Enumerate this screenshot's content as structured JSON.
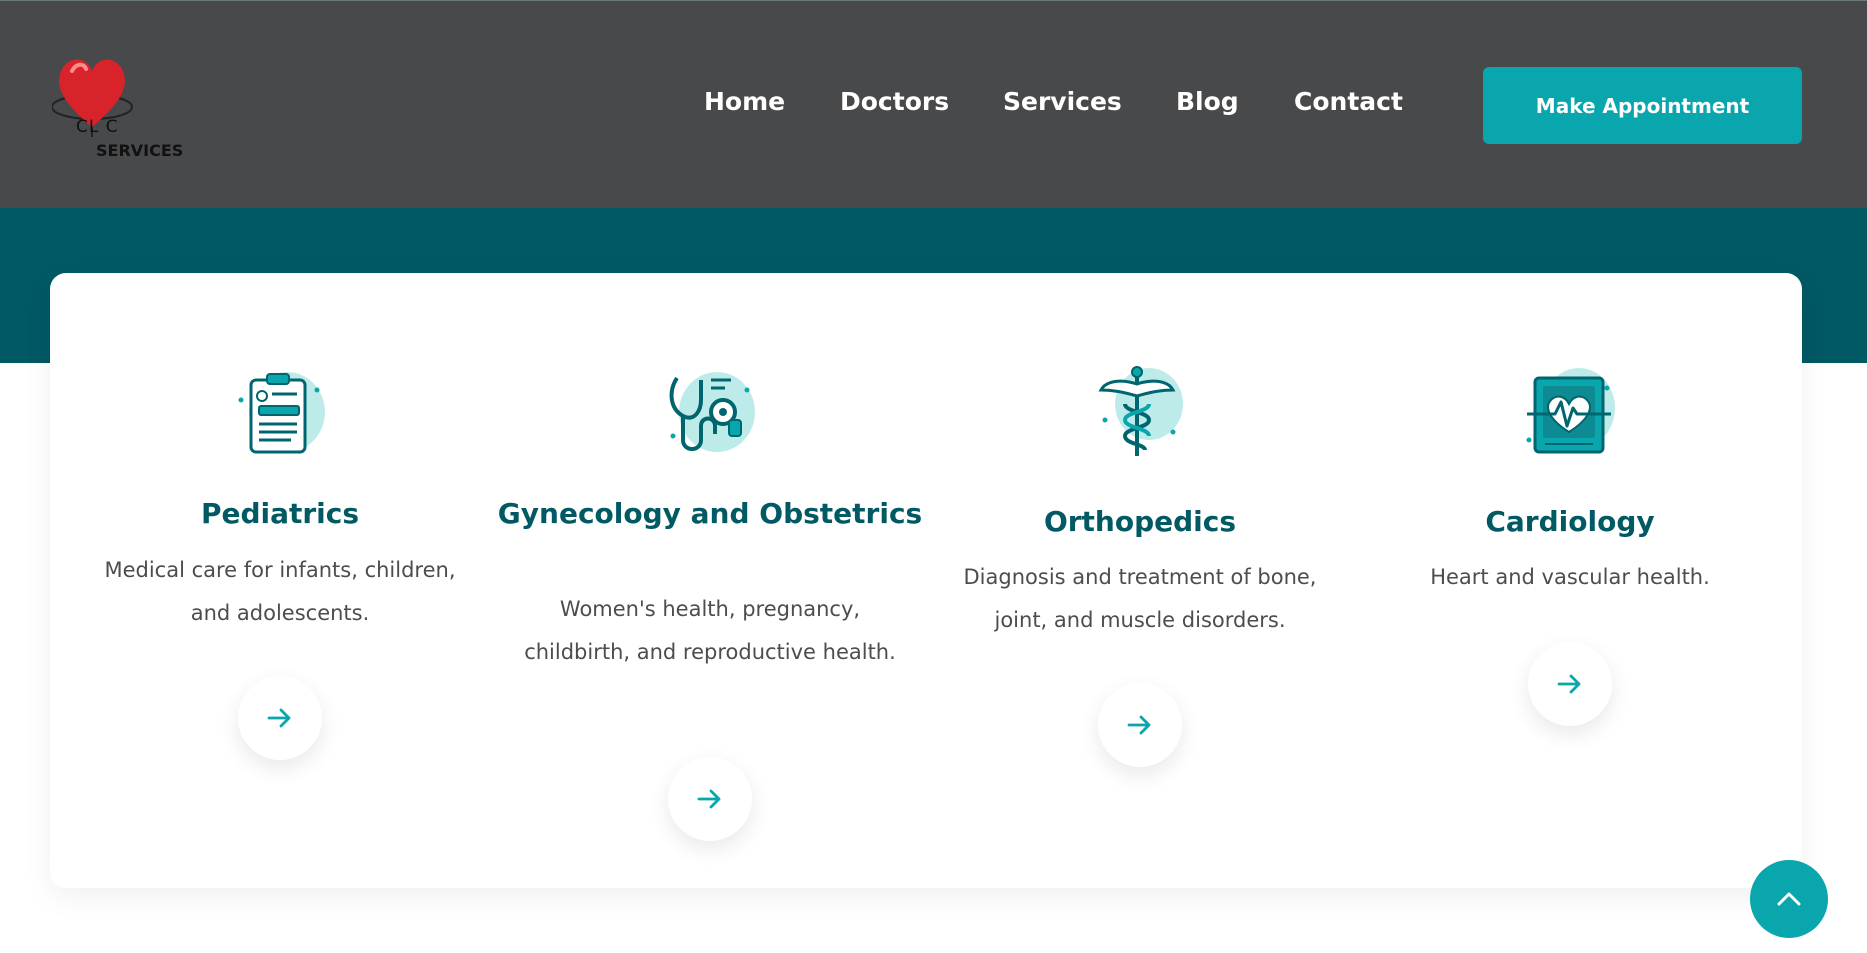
{
  "logo": {
    "line1": "CL  C",
    "line2": "SERVICES"
  },
  "nav": {
    "items": [
      {
        "label": "Home"
      },
      {
        "label": "Doctors"
      },
      {
        "label": "Services"
      },
      {
        "label": "Blog"
      },
      {
        "label": "Contact"
      }
    ],
    "cta_label": "Make Appointment"
  },
  "colors": {
    "header_bg": "#48494b",
    "band_bg": "#005963",
    "accent": "#0aa6ad",
    "title": "#005963",
    "text": "#4d4d4d"
  },
  "services": [
    {
      "title": "Pediatrics",
      "description": "Medical care for infants, children, and adolescents.",
      "icon": "clipboard-icon"
    },
    {
      "title": "Gynecology and Obstetrics",
      "description": "Women's health, pregnancy, childbirth, and reproductive health.",
      "icon": "stethoscope-icon"
    },
    {
      "title": "Orthopedics",
      "description": "Diagnosis and treatment of bone, joint, and muscle disorders.",
      "icon": "caduceus-icon"
    },
    {
      "title": "Cardiology",
      "description": "Heart and vascular health.",
      "icon": "heart-monitor-icon"
    }
  ],
  "icons": {
    "service_link": "arrow-right-icon",
    "scroll_top": "chevron-up-icon"
  }
}
